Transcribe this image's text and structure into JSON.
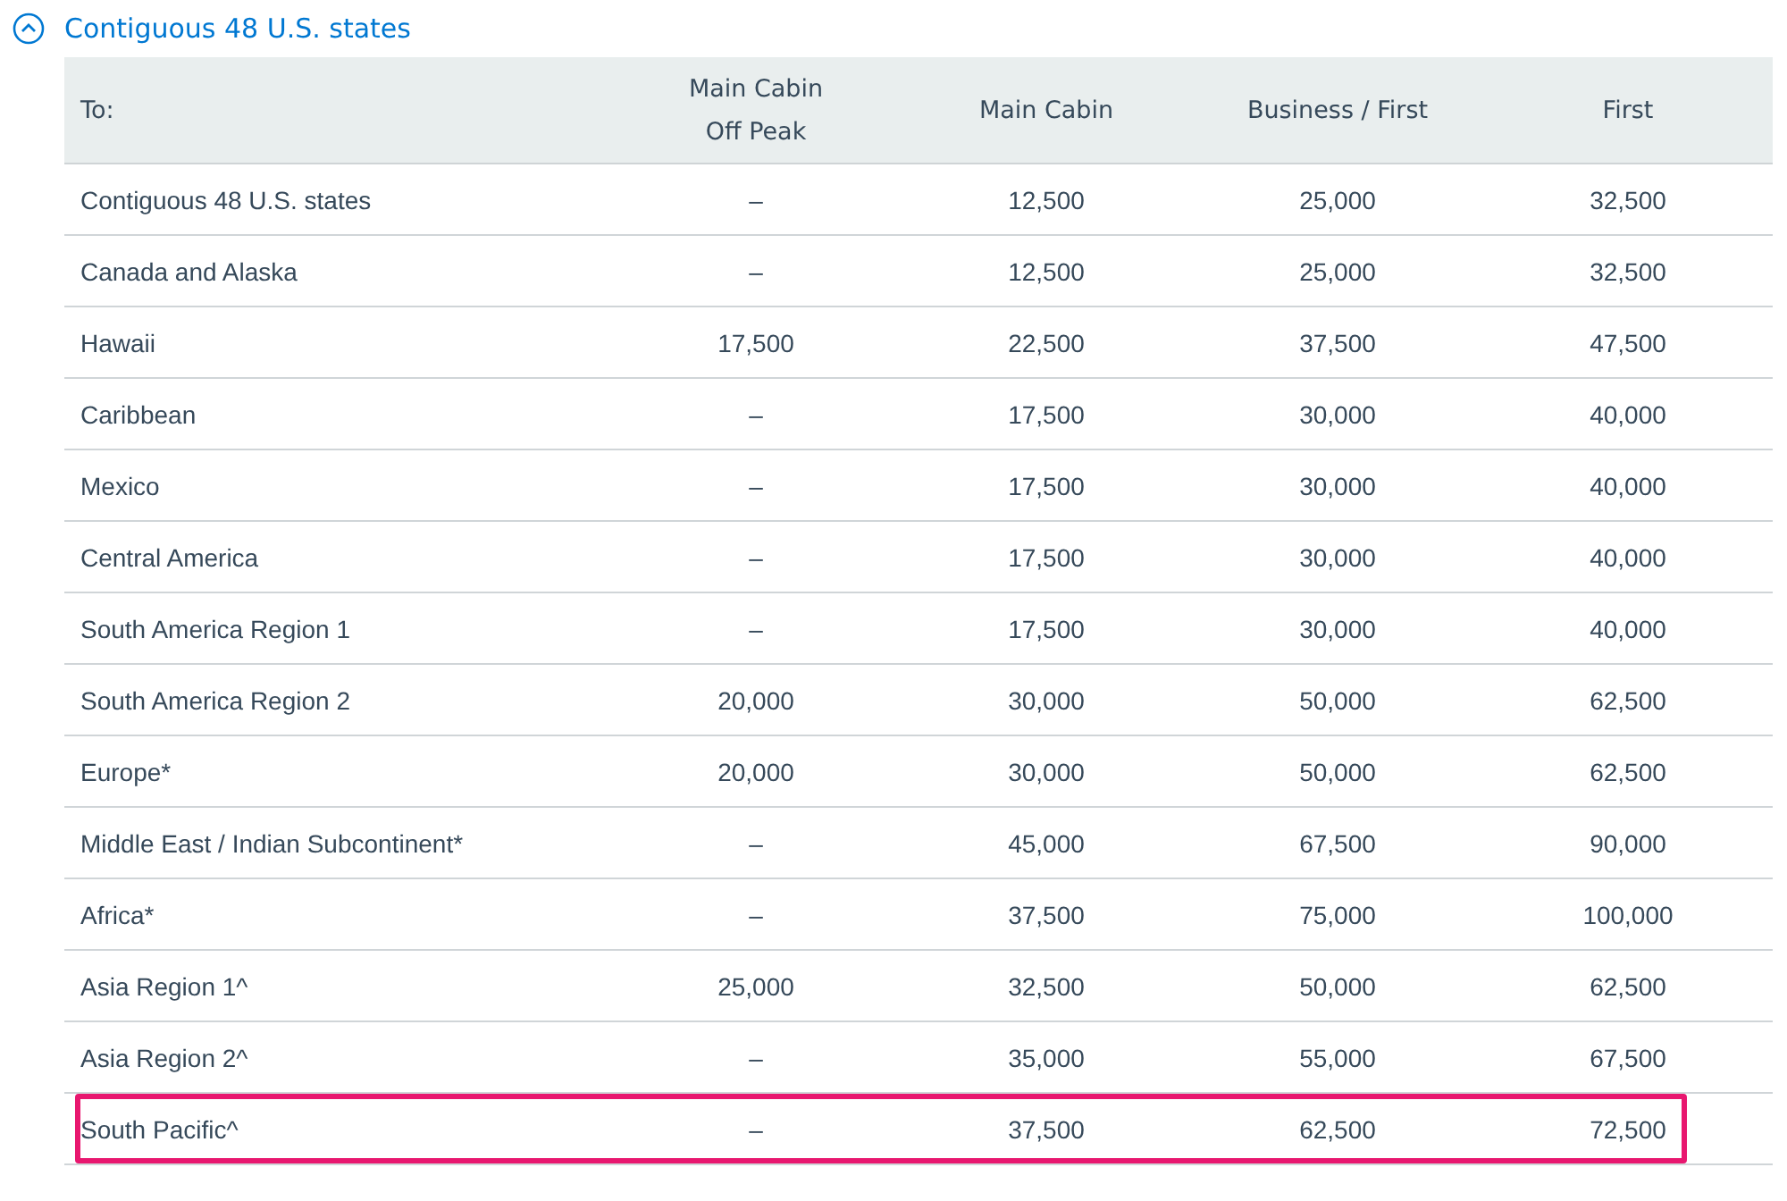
{
  "section": {
    "title": "Contiguous 48 U.S. states",
    "expanded": true
  },
  "table": {
    "columns": [
      {
        "label": "To:"
      },
      {
        "label": "Main Cabin\nOff Peak"
      },
      {
        "label": "Main Cabin"
      },
      {
        "label": "Business / First"
      },
      {
        "label": "First"
      }
    ],
    "rows": [
      {
        "cells": [
          "Contiguous 48 U.S. states",
          "–",
          "12,500",
          "25,000",
          "32,500"
        ],
        "highlighted": false
      },
      {
        "cells": [
          "Canada and Alaska",
          "–",
          "12,500",
          "25,000",
          "32,500"
        ],
        "highlighted": false
      },
      {
        "cells": [
          "Hawaii",
          "17,500",
          "22,500",
          "37,500",
          "47,500"
        ],
        "highlighted": false
      },
      {
        "cells": [
          "Caribbean",
          "–",
          "17,500",
          "30,000",
          "40,000"
        ],
        "highlighted": false
      },
      {
        "cells": [
          "Mexico",
          "–",
          "17,500",
          "30,000",
          "40,000"
        ],
        "highlighted": false
      },
      {
        "cells": [
          "Central America",
          "–",
          "17,500",
          "30,000",
          "40,000"
        ],
        "highlighted": false
      },
      {
        "cells": [
          "South America Region 1",
          "–",
          "17,500",
          "30,000",
          "40,000"
        ],
        "highlighted": false
      },
      {
        "cells": [
          "South America Region 2",
          "20,000",
          "30,000",
          "50,000",
          "62,500"
        ],
        "highlighted": false
      },
      {
        "cells": [
          "Europe*",
          "20,000",
          "30,000",
          "50,000",
          "62,500"
        ],
        "highlighted": false
      },
      {
        "cells": [
          "Middle East / Indian Subcontinent*",
          "–",
          "45,000",
          "67,500",
          "90,000"
        ],
        "highlighted": false
      },
      {
        "cells": [
          "Africa*",
          "–",
          "37,500",
          "75,000",
          "100,000"
        ],
        "highlighted": false
      },
      {
        "cells": [
          "Asia Region 1^",
          "25,000",
          "32,500",
          "50,000",
          "62,500"
        ],
        "highlighted": false
      },
      {
        "cells": [
          "Asia Region 2^",
          "–",
          "35,000",
          "55,000",
          "67,500"
        ],
        "highlighted": false
      },
      {
        "cells": [
          "South Pacific^",
          "–",
          "37,500",
          "62,500",
          "72,500"
        ],
        "highlighted": true
      }
    ]
  }
}
